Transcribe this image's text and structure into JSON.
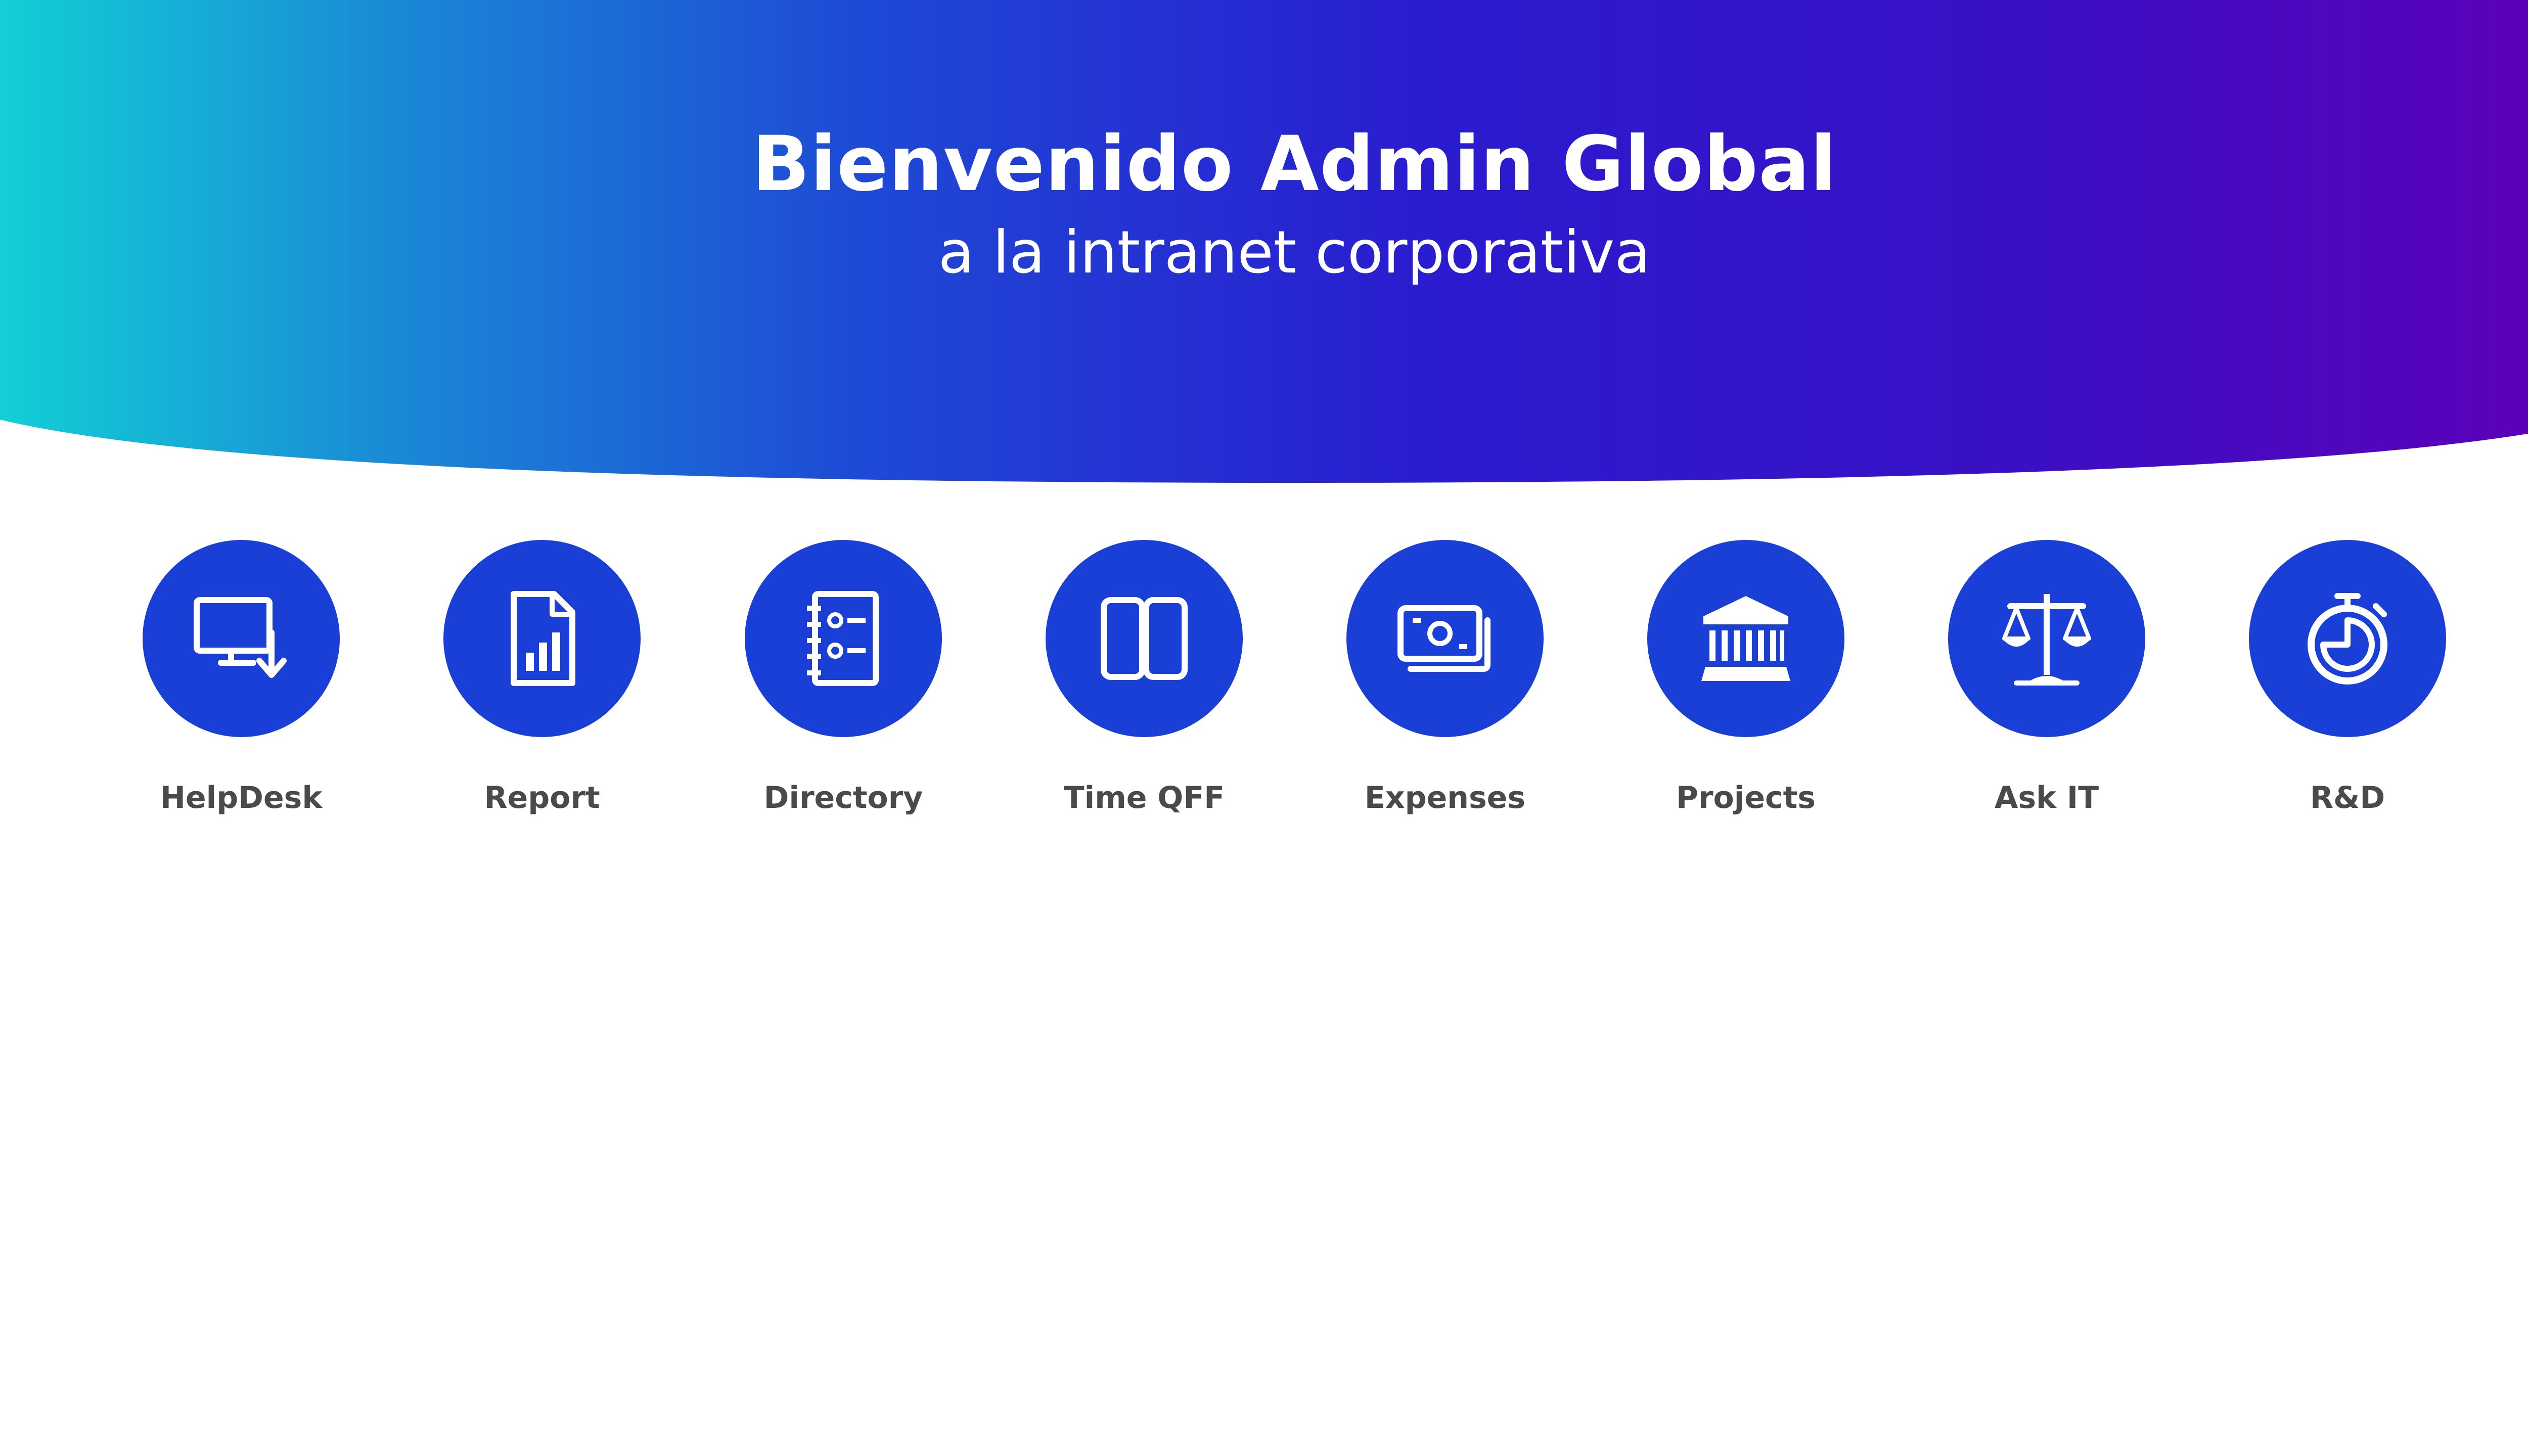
{
  "colors": {
    "gradient_start": "#12cfd6",
    "gradient_mid": "#2a1ccf",
    "gradient_end": "#5f00b8",
    "app_circle": "#1a3fd6",
    "app_label": "#4a4a4a",
    "icon": "#ffffff"
  },
  "header": {
    "title": "Bienvenido Admin Global",
    "subtitle": "a la intranet corporativa"
  },
  "apps": [
    {
      "label": "HelpDesk",
      "icon": "monitor-download-icon"
    },
    {
      "label": "Report",
      "icon": "report-file-icon"
    },
    {
      "label": "Directory",
      "icon": "directory-book-icon"
    },
    {
      "label": "Time QFF",
      "icon": "open-book-icon"
    },
    {
      "label": "Expenses",
      "icon": "money-icon"
    },
    {
      "label": "Projects",
      "icon": "bank-building-icon"
    },
    {
      "label": "Ask IT",
      "icon": "scales-icon"
    },
    {
      "label": "R&D",
      "icon": "stopwatch-icon"
    }
  ]
}
